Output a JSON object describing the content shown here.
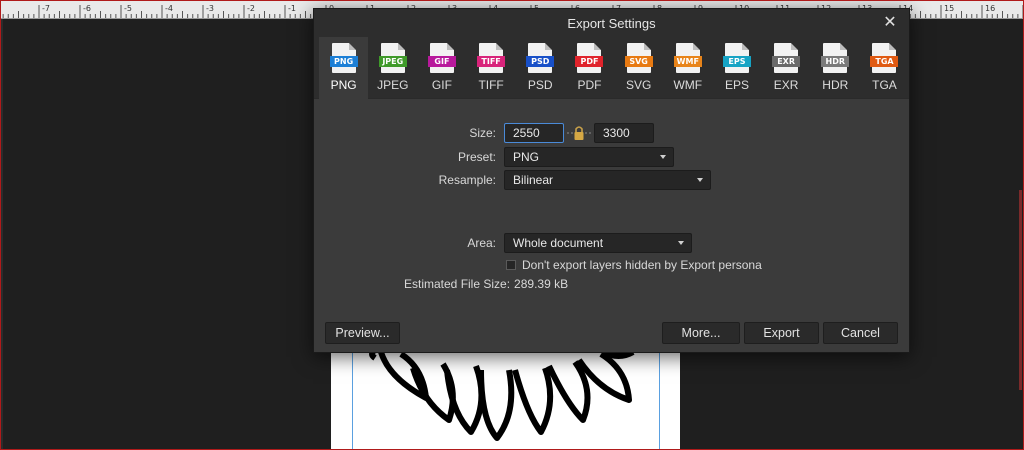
{
  "ruler": {
    "labels": [
      "-7",
      "-6",
      "-5",
      "-4",
      "-3",
      "-2",
      "-1",
      "0",
      "1",
      "2",
      "3",
      "4",
      "5",
      "6",
      "7",
      "8",
      "9",
      "10",
      "11",
      "12",
      "13",
      "14",
      "15",
      "16"
    ]
  },
  "dialog": {
    "title": "Export Settings",
    "close_icon": "close-icon",
    "formats": [
      {
        "label": "PNG",
        "tag": "PNG",
        "color": "#1c7fd6",
        "active": true
      },
      {
        "label": "JPEG",
        "tag": "JPEG",
        "color": "#3f9a2a",
        "active": false
      },
      {
        "label": "GIF",
        "tag": "GIF",
        "color": "#b8199c",
        "active": false
      },
      {
        "label": "TIFF",
        "tag": "TIFF",
        "color": "#d8237a",
        "active": false
      },
      {
        "label": "PSD",
        "tag": "PSD",
        "color": "#1850c8",
        "active": false
      },
      {
        "label": "PDF",
        "tag": "PDF",
        "color": "#e0232b",
        "active": false
      },
      {
        "label": "SVG",
        "tag": "SVG",
        "color": "#e87a12",
        "active": false
      },
      {
        "label": "WMF",
        "tag": "WMF",
        "color": "#e8841a",
        "active": false
      },
      {
        "label": "EPS",
        "tag": "EPS",
        "color": "#16a3c4",
        "active": false
      },
      {
        "label": "EXR",
        "tag": "EXR",
        "color": "#6a6a6a",
        "active": false
      },
      {
        "label": "HDR",
        "tag": "HDR",
        "color": "#7a7a7a",
        "active": false
      },
      {
        "label": "TGA",
        "tag": "TGA",
        "color": "#e05a12",
        "active": false
      }
    ],
    "size": {
      "label": "Size:",
      "width": "2550 px",
      "height": "3300 px",
      "lock_icon": "lock-icon"
    },
    "preset": {
      "label": "Preset:",
      "value": "PNG"
    },
    "resample": {
      "label": "Resample:",
      "value": "Bilinear"
    },
    "area": {
      "label": "Area:",
      "value": "Whole document"
    },
    "hidden_layers": {
      "label": "Don't export layers hidden by Export persona",
      "checked": false
    },
    "file_size": {
      "label": "Estimated File Size:",
      "value": "289.39 kB"
    },
    "buttons": {
      "preview": "Preview...",
      "more": "More...",
      "export": "Export",
      "cancel": "Cancel"
    }
  }
}
